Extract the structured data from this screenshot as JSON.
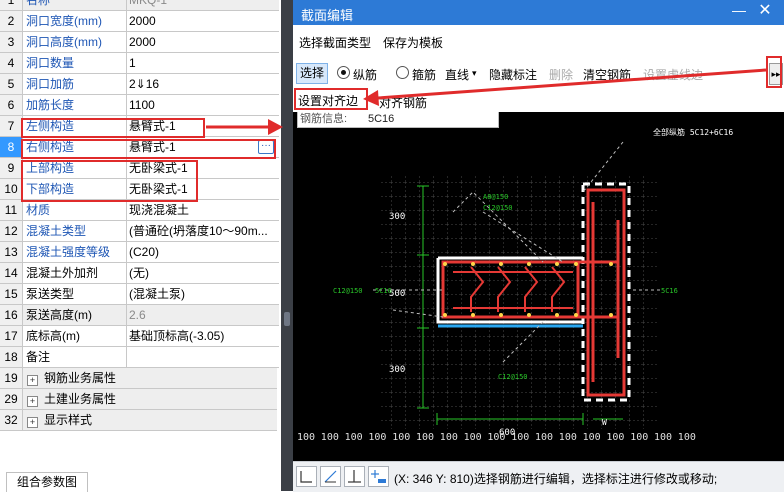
{
  "props": [
    {
      "num": "1",
      "name": "名称",
      "value": "MKQ-1",
      "blue": true,
      "grey": true
    },
    {
      "num": "2",
      "name": "洞口宽度(mm)",
      "value": "2000",
      "blue": true
    },
    {
      "num": "3",
      "name": "洞口高度(mm)",
      "value": "2000",
      "blue": true
    },
    {
      "num": "4",
      "name": "洞口数量",
      "value": "1",
      "blue": true
    },
    {
      "num": "5",
      "name": "洞口加筋",
      "value": "2⇓16",
      "blue": true
    },
    {
      "num": "6",
      "name": "加筋长度",
      "value": "1100",
      "blue": true
    },
    {
      "num": "7",
      "name": "左侧构造",
      "value": "悬臂式-1",
      "blue": true
    },
    {
      "num": "8",
      "name": "右侧构造",
      "value": "悬臂式-1",
      "blue": true,
      "selected": true
    },
    {
      "num": "9",
      "name": "上部构造",
      "value": "无卧梁式-1",
      "blue": true
    },
    {
      "num": "10",
      "name": "下部构造",
      "value": "无卧梁式-1",
      "blue": true
    },
    {
      "num": "11",
      "name": "材质",
      "value": "现浇混凝土",
      "blue": true
    },
    {
      "num": "12",
      "name": "混凝土类型",
      "value": "(普通砼(坍落度10～90m...",
      "blue": true
    },
    {
      "num": "13",
      "name": "混凝土强度等级",
      "value": "(C20)",
      "blue": true
    },
    {
      "num": "14",
      "name": "混凝土外加剂",
      "value": "(无)",
      "blue": false
    },
    {
      "num": "15",
      "name": "泵送类型",
      "value": "(混凝土泵)",
      "blue": false
    },
    {
      "num": "16",
      "name": "泵送高度(m)",
      "value": "2.6",
      "blue": false,
      "grey": true
    },
    {
      "num": "17",
      "name": "底标高(m)",
      "value": "基础顶标高(-3.05)",
      "blue": false
    },
    {
      "num": "18",
      "name": "备注",
      "value": "",
      "blue": false
    }
  ],
  "groups": [
    {
      "num": "19",
      "label": "钢筋业务属性"
    },
    {
      "num": "29",
      "label": "土建业务属性"
    },
    {
      "num": "32",
      "label": "显示样式"
    }
  ],
  "bottom_tab": "组合参数图",
  "editor": {
    "title": "截面编辑",
    "menu": [
      "选择截面类型",
      "保存为模板"
    ],
    "toolbar": {
      "select": "选择",
      "radio_long": "纵筋",
      "radio_stirrup": "箍筋",
      "line": "直线",
      "hide_labels": "隐藏标注",
      "delete": "删除",
      "clear_rebar": "清空钢筋",
      "set_bend": "设置虚线边",
      "more": "▸▸"
    },
    "subbar": {
      "set_align": "设置对齐边",
      "align_rebar": "对齐钢筋"
    },
    "info_label": "钢筋信息:",
    "info_value": "5C16",
    "canvas": {
      "title_label": "全部纵筋  5C12+6C16",
      "dim_300_top": "300",
      "dim_500": "500",
      "dim_300_bot": "300",
      "dim_600": "600",
      "dim_w": "W",
      "label_a8": "A8@150",
      "label_c12_top": "C12@150",
      "label_c12_left": "C12@150",
      "label_c16_left": "5C16",
      "label_c12_bot": "C12@150",
      "label_c16_right": "5C16",
      "grid_tick": "100"
    },
    "status": "(X: 346 Y: 810)选择钢筋进行编辑，选择标注进行修改或移动;"
  },
  "colors": {
    "accent": "#2d7ad6",
    "annotation": "#e02b2b",
    "rebar": "#e53935",
    "concrete": "#ffffff",
    "dim": "#29c629"
  }
}
